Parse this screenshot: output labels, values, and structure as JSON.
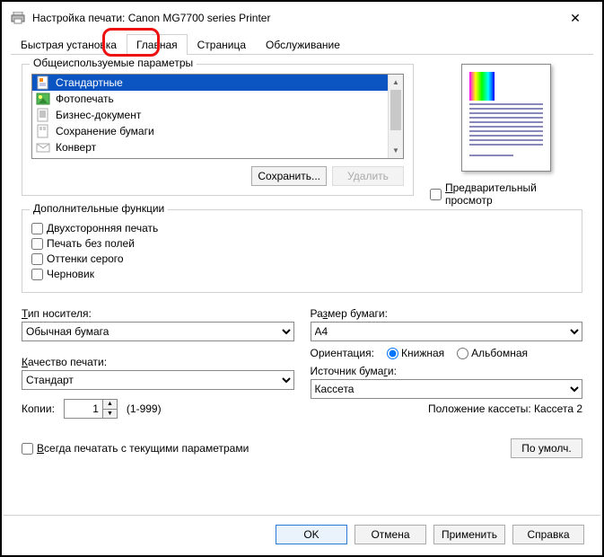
{
  "title": "Настройка печати: Canon MG7700 series Printer",
  "tabs": {
    "quick": "Быстрая установка",
    "main": "Главная",
    "page": "Страница",
    "service": "Обслуживание"
  },
  "group_common": "Общеиспользуемые параметры",
  "presets": [
    "Стандартные",
    "Фотопечать",
    "Бизнес-документ",
    "Сохранение бумаги",
    "Конверт"
  ],
  "buttons": {
    "save": "Сохранить...",
    "delete": "Удалить",
    "defaults": "По умолч.",
    "ok": "OK",
    "cancel": "Отмена",
    "apply": "Применить",
    "help": "Справка"
  },
  "preview_checkbox": "Предварительный просмотр",
  "group_extra": "Дополнительные функции",
  "extra": {
    "duplex": "Двухсторонняя печать",
    "borderless": "Печать без полей",
    "grayscale": "Оттенки серого",
    "draft": "Черновик"
  },
  "fields": {
    "media_label": "Тип носителя:",
    "media_value": "Обычная бумага",
    "quality_label": "Качество печати:",
    "quality_value": "Стандарт",
    "size_label": "Размер бумаги:",
    "size_value": "A4",
    "orientation_label": "Ориентация:",
    "orientation_portrait": "Книжная",
    "orientation_landscape": "Альбомная",
    "source_label": "Источник бумаги:",
    "source_value": "Кассета",
    "cassette_note": "Положение кассеты: Кассета 2",
    "copies_label": "Копии:",
    "copies_value": "1",
    "copies_range": "(1-999)"
  },
  "always_print": "Всегда печатать с текущими параметрами"
}
